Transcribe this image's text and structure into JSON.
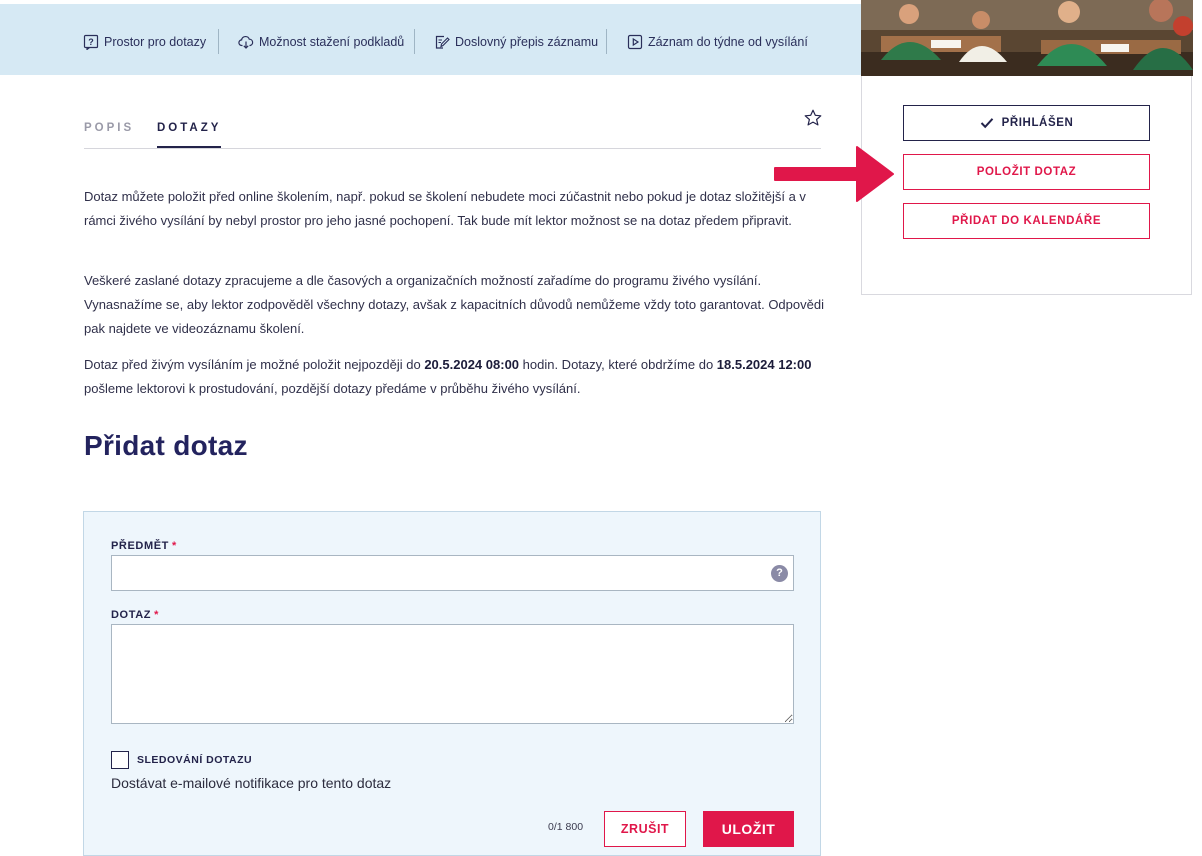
{
  "features": [
    {
      "label": "Prostor pro dotazy",
      "icon": "question-box-icon"
    },
    {
      "label": "Možnost stažení podkladů",
      "icon": "cloud-download-icon"
    },
    {
      "label": "Doslovný přepis záznamu",
      "icon": "edit-document-icon"
    },
    {
      "label": "Záznam do týdne od vysílání",
      "icon": "video-play-icon"
    }
  ],
  "sidebar": {
    "signed_label": "PŘIHLÁŠEN",
    "ask_label": "POLOŽIT DOTAZ",
    "calendar_label": "PŘIDAT DO KALENDÁŘE"
  },
  "tabs": {
    "popis": "POPIS",
    "dotazy": "DOTAZY",
    "active": "DOTAZY"
  },
  "description": {
    "p1": "Dotaz můžete položit před online školením, např. pokud se školení nebudete moci zúčastnit nebo pokud je dotaz složitější a v rámci živého vysílání by nebyl prostor pro jeho jasné pochopení. Tak bude mít lektor možnost se na dotaz předem připravit.",
    "p2": "Veškeré zaslané dotazy zpracujeme a dle časových a organizačních možností zařadíme do programu živého vysílání. Vynasnažíme se, aby lektor zodpověděl všechny dotazy, avšak z kapacitních důvodů nemůžeme vždy toto garantovat. Odpovědi pak najdete ve videozáznamu školení.",
    "p3_a": "Dotaz před živým vysíláním je možné položit nejpozději do ",
    "p3_deadline": "20.5.2024 08:00",
    "p3_b": " hodin. Dotazy, které obdržíme do ",
    "p3_review": "18.5.2024 12:00",
    "p3_c": " pošleme lektorovi k prostudování, pozdější dotazy předáme v průběhu živého vysílání."
  },
  "form": {
    "heading": "Přidat dotaz",
    "subject_label": "PŘEDMĚT",
    "required_mark": "*",
    "subject_value": "",
    "help_glyph": "?",
    "question_label": "DOTAZ",
    "question_value": "",
    "follow_label": "SLEDOVÁNÍ DOTAZU",
    "follow_description": "Dostávat e-mailové notifikace pro tento dotaz",
    "follow_checked": false,
    "counter": "0/1 800",
    "cancel_label": "ZRUŠIT",
    "save_label": "ULOŽIT"
  },
  "colors": {
    "accent": "#e0174a",
    "navy": "#23234a",
    "band": "#d6e9f4",
    "form_bg": "#eef6fc"
  }
}
